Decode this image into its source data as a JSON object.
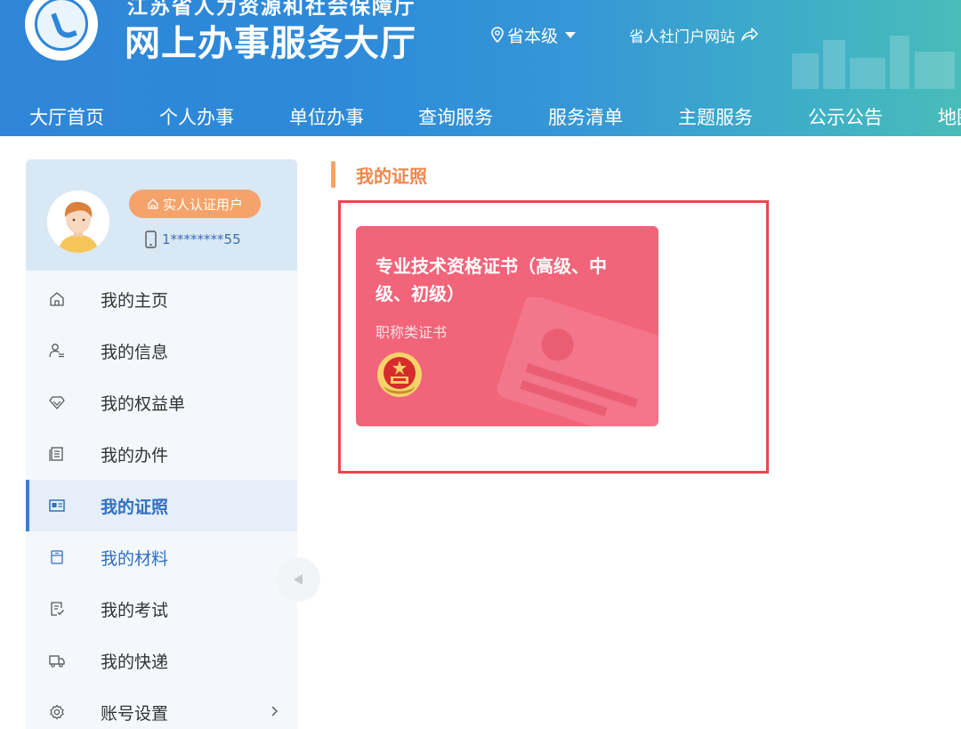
{
  "header": {
    "org_name": "江苏省人力资源和社会保障厅",
    "site_title": "网上办事服务大厅",
    "region": "省本级",
    "portal_link": "省人社门户网站"
  },
  "nav": {
    "items": [
      "大厅首页",
      "个人办事",
      "单位办事",
      "查询服务",
      "服务清单",
      "主题服务",
      "公示公告",
      "地图"
    ]
  },
  "profile": {
    "badge": "实人认证用户",
    "phone": "1********55"
  },
  "sidebar": {
    "items": [
      {
        "label": "我的主页",
        "icon": "home-icon"
      },
      {
        "label": "我的信息",
        "icon": "user-info-icon"
      },
      {
        "label": "我的权益单",
        "icon": "diamond-icon"
      },
      {
        "label": "我的办件",
        "icon": "document-list-icon"
      },
      {
        "label": "我的证照",
        "icon": "id-card-icon"
      },
      {
        "label": "我的材料",
        "icon": "folder-icon"
      },
      {
        "label": "我的考试",
        "icon": "exam-icon"
      },
      {
        "label": "我的快递",
        "icon": "truck-icon"
      },
      {
        "label": "账号设置",
        "icon": "gear-icon"
      }
    ],
    "active_index": 4
  },
  "main": {
    "section_title": "我的证照",
    "certificate": {
      "title": "专业技术资格证书（高级、中级、初级）",
      "type": "职称类证书"
    }
  },
  "colors": {
    "header_blue": "#2f86d8",
    "accent_orange": "#f5a36a",
    "card_red": "#f2647a",
    "highlight_red": "#e9474f",
    "active_blue": "#3b7fd0"
  }
}
